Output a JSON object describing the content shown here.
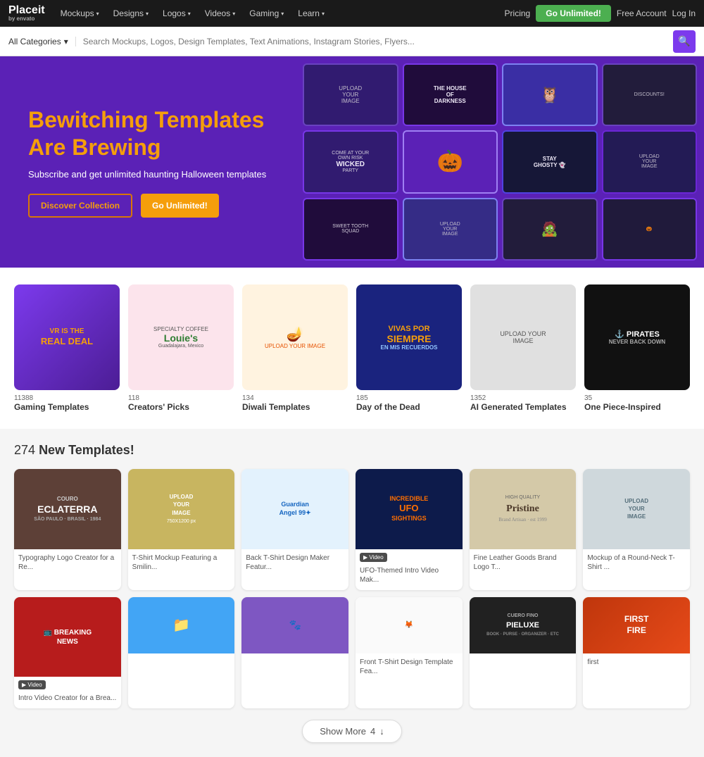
{
  "nav": {
    "logo_main": "Placeit",
    "logo_sub": "by envato",
    "items": [
      {
        "label": "Mockups",
        "id": "mockups"
      },
      {
        "label": "Designs",
        "id": "designs"
      },
      {
        "label": "Logos",
        "id": "logos"
      },
      {
        "label": "Videos",
        "id": "videos"
      },
      {
        "label": "Gaming",
        "id": "gaming"
      },
      {
        "label": "Learn",
        "id": "learn"
      }
    ],
    "pricing": "Pricing",
    "go_unlimited": "Go Unlimited!",
    "free_account": "Free Account",
    "log_in": "Log In"
  },
  "search": {
    "category_label": "All Categories",
    "placeholder": "Search Mockups, Logos, Design Templates, Text Animations, Instagram Stories, Flyers..."
  },
  "hero": {
    "title": "Bewitching Templates Are Brewing",
    "subtitle": "Subscribe and get unlimited haunting Halloween templates",
    "btn_discover": "Discover Collection",
    "btn_unlimited": "Go Unlimited!"
  },
  "categories": {
    "items": [
      {
        "count": "11388",
        "name": "Gaming Templates",
        "bg": "gaming"
      },
      {
        "count": "118",
        "name": "Creators' Picks",
        "bg": "creators"
      },
      {
        "count": "134",
        "name": "Diwali Templates",
        "bg": "diwali"
      },
      {
        "count": "185",
        "name": "Day of the Dead",
        "bg": "dotd"
      },
      {
        "count": "1352",
        "name": "AI Generated Templates",
        "bg": "ai"
      },
      {
        "count": "35",
        "name": "One Piece-Inspired",
        "bg": "pirates"
      }
    ]
  },
  "templates": {
    "count": "274",
    "title": "New Templates!",
    "show_more": "Show More",
    "show_more_num": "4",
    "items": [
      {
        "label": "Typography Logo Creator for a Re...",
        "bg": "bg-brown",
        "text": "COURO\nECLATERRA",
        "row": 1,
        "col": 1
      },
      {
        "label": "T-Shirt Mockup Featuring a Smilin...",
        "bg": "bg-outdoor",
        "text": "UPLOAD\nYOUR\nIMAGE\n750X1200 px",
        "row": 1,
        "col": 2
      },
      {
        "label": "Back T-Shirt Design Maker Featur...",
        "bg": "bg-angel",
        "text": "Guardian\nAngel 99",
        "row": 1,
        "col": 3
      },
      {
        "label": "UFO-Themed Intro Video Mak...",
        "bg": "bg-video-ufo",
        "text": "INCREDIBLE\nUFO\nSIGHTINGS",
        "row": 1,
        "col": 4,
        "video": true
      },
      {
        "label": "Fine Leather Goods Brand Logo T...",
        "bg": "bg-cream",
        "text": "HIGH QUALITY\nPRISTINE",
        "row": 1,
        "col": 5
      },
      {
        "label": "Mockup of a Round-Neck T-Shirt ...",
        "bg": "bg-tshirt",
        "text": "UPLOAD\nYOUR\nIMAGE",
        "row": 1,
        "col": 6
      },
      {
        "label": "Intro Video Creator for a Brea...",
        "bg": "bg-news",
        "text": "BREAKING\nNEWS",
        "row": 2,
        "col": 1,
        "video": true
      },
      {
        "label": "",
        "bg": "bg-folder",
        "text": "",
        "row": 2,
        "col": 2
      },
      {
        "label": "",
        "bg": "bg-purple",
        "text": "",
        "row": 2,
        "col": 3
      },
      {
        "label": "Front T-Shirt Design Template Fea...",
        "bg": "bg-white-t",
        "text": "",
        "row": 2,
        "col": 4
      },
      {
        "label": "",
        "bg": "bg-pieluxe",
        "text": "CUERO FINO\nPIELUXE",
        "row": 2,
        "col": 5
      },
      {
        "label": "first",
        "bg": "bg-first-fire",
        "text": "FIRST\nFIRE",
        "row": 2,
        "col": 6
      }
    ]
  }
}
